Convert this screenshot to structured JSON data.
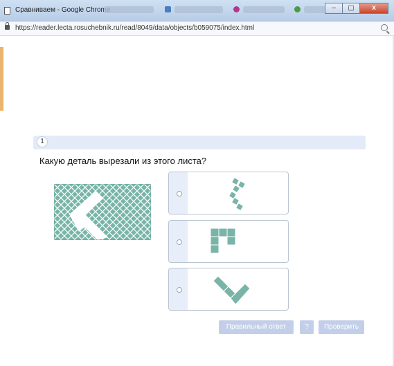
{
  "window": {
    "title": "Сравниваем - Google Chrome",
    "url": "https://reader.lecta.rosuchebnik.ru/read/8049/data/objects/b059075/index.html",
    "controls": [
      "–",
      "▢",
      "x"
    ]
  },
  "question": {
    "number": "1",
    "text": "Какую деталь вырезали из этого листа?"
  },
  "options": [
    {
      "name": "option-1",
      "selected": false,
      "piece_icon": "angled-pentomino-piece"
    },
    {
      "name": "option-2",
      "selected": false,
      "piece_icon": "hook-square-piece"
    },
    {
      "name": "option-3",
      "selected": false,
      "piece_icon": "v-shaped-piece"
    }
  ],
  "buttons": {
    "correct_answer": "Правильный ответ",
    "help": "?",
    "check": "Проверить"
  },
  "colors": {
    "tile": "#78b5a8",
    "tile_grid": "#ffffff",
    "button": "#c3cfe8",
    "header_bar": "#e3ebf8"
  }
}
